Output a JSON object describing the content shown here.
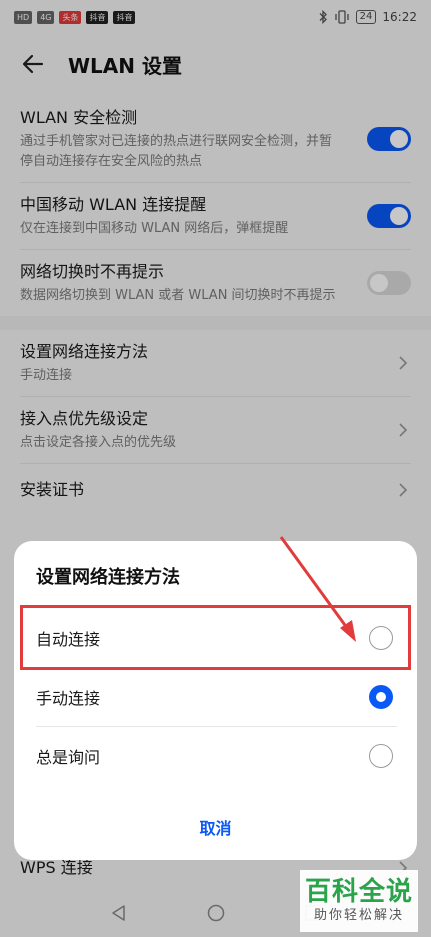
{
  "status_bar": {
    "left_chips": [
      "HD",
      "4G",
      "头条",
      "抖音",
      "抖音"
    ],
    "battery": "24",
    "time": "16:22"
  },
  "app_bar": {
    "title": "WLAN 设置"
  },
  "settings": {
    "security_check": {
      "title": "WLAN 安全检测",
      "sub": "通过手机管家对已连接的热点进行联网安全检测，并暂停自动连接存在安全风险的热点",
      "on": true
    },
    "cmcc_prompt": {
      "title": "中国移动 WLAN 连接提醒",
      "sub": "仅在连接到中国移动 WLAN 网络后，弹框提醒",
      "on": true
    },
    "no_switch_prompt": {
      "title": "网络切换时不再提示",
      "sub": "数据网络切换到 WLAN 或者 WLAN 间切换时不再提示",
      "on": false
    },
    "connect_method": {
      "title": "设置网络连接方法",
      "sub": "手动连接"
    },
    "ap_priority": {
      "title": "接入点优先级设定",
      "sub": "点击设定各接入点的优先级"
    },
    "install_cert": {
      "title": "安装证书"
    },
    "wps": {
      "title": "WPS 连接"
    }
  },
  "dialog": {
    "title": "设置网络连接方法",
    "options": [
      {
        "label": "自动连接",
        "selected": false
      },
      {
        "label": "手动连接",
        "selected": true
      },
      {
        "label": "总是询问",
        "selected": false
      }
    ],
    "cancel_label": "取消"
  },
  "watermark": {
    "main": "百科全说",
    "sub": "助你轻松解决"
  },
  "colors": {
    "accent": "#0a59f7",
    "annotation": "#e23b3b",
    "watermark_green": "#2aa34a"
  }
}
